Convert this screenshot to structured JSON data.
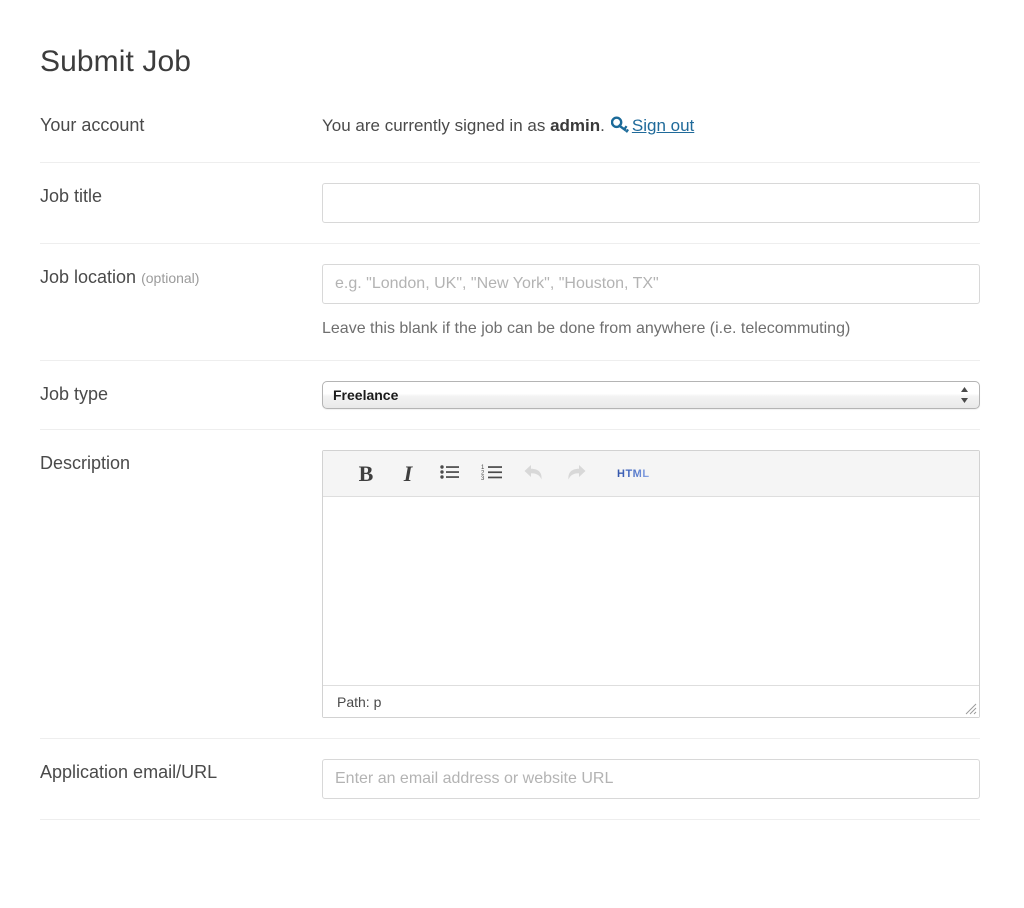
{
  "page": {
    "title": "Submit Job"
  },
  "theme": {
    "link_color": "#1f6a9a",
    "key_icon_color": "#1b6a99",
    "text_color": "#4a4a4a",
    "divider_color": "#eeeeee",
    "placeholder_color": "#b3b3b3"
  },
  "fields": {
    "account": {
      "label": "Your account",
      "text_before": "You are currently signed in as ",
      "username": "admin",
      "text_after": ".",
      "key_icon": "key-icon",
      "signout_label": "Sign out"
    },
    "job_title": {
      "label": "Job title",
      "value": "",
      "placeholder": ""
    },
    "job_location": {
      "label": "Job location",
      "optional_note": "(optional)",
      "value": "",
      "placeholder": "e.g. \"London, UK\", \"New York\", \"Houston, TX\"",
      "help_text": "Leave this blank if the job can be done from anywhere (i.e. telecommuting)"
    },
    "job_type": {
      "label": "Job type",
      "selected": "Freelance",
      "options": [
        "Freelance"
      ],
      "stepper_icon": "up-down-arrows-icon"
    },
    "description": {
      "label": "Description",
      "toolbar": [
        {
          "name": "bold-button",
          "glyph": "B",
          "title": "Bold",
          "disabled": false
        },
        {
          "name": "italic-button",
          "glyph": "I",
          "title": "Italic",
          "disabled": false
        },
        {
          "name": "bullet-list-button",
          "glyph": "bullet-list-icon",
          "title": "Unordered list",
          "disabled": false
        },
        {
          "name": "numbered-list-button",
          "glyph": "numbered-list-icon",
          "title": "Ordered list",
          "disabled": false
        },
        {
          "name": "undo-button",
          "glyph": "undo-icon",
          "title": "Undo",
          "disabled": true
        },
        {
          "name": "redo-button",
          "glyph": "redo-icon",
          "title": "Redo",
          "disabled": true
        },
        {
          "name": "html-button",
          "glyph": "HTML",
          "title": "Edit HTML",
          "disabled": false
        }
      ],
      "content": "",
      "path_status": "Path: p"
    },
    "application": {
      "label": "Application email/URL",
      "value": "",
      "placeholder": "Enter an email address or website URL"
    }
  }
}
